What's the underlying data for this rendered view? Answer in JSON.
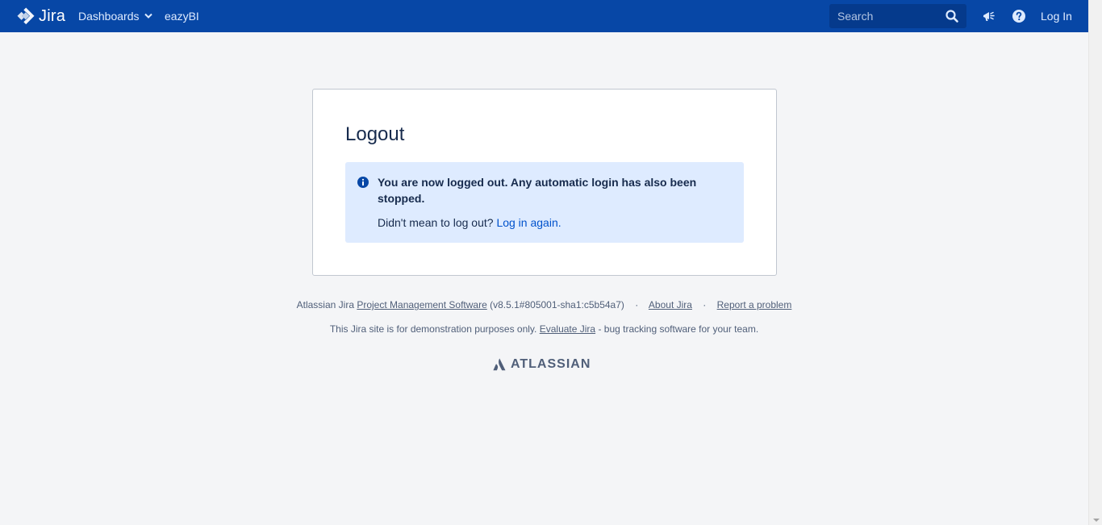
{
  "header": {
    "logo_text": "Jira",
    "nav": {
      "dashboards_label": "Dashboards",
      "eazybi_label": "eazyBI"
    },
    "search": {
      "placeholder": "Search"
    },
    "login_label": "Log In",
    "icons": [
      "jira-logo-icon",
      "chevron-down-icon",
      "search-icon",
      "megaphone-icon",
      "help-icon"
    ]
  },
  "main": {
    "title": "Logout",
    "info": {
      "message": "You are now logged out. Any automatic login has also been stopped.",
      "prompt": "Didn't mean to log out?",
      "link_label": "Log in again."
    }
  },
  "footer": {
    "line1": {
      "prefix": "Atlassian Jira",
      "pm_link": "Project Management Software",
      "version": "(v8.5.1#805001-sha1:c5b54a7)",
      "about_link": "About Jira",
      "report_link": "Report a problem"
    },
    "line2": {
      "prefix": "This Jira site is for demonstration purposes only.",
      "evaluate_link": "Evaluate Jira",
      "suffix": "- bug tracking software for your team."
    },
    "brand": "ATLASSIAN"
  },
  "colors": {
    "header_bg": "#0747a6",
    "info_bg": "#deebff",
    "link": "#0052cc",
    "page_bg": "#f4f5f7"
  }
}
